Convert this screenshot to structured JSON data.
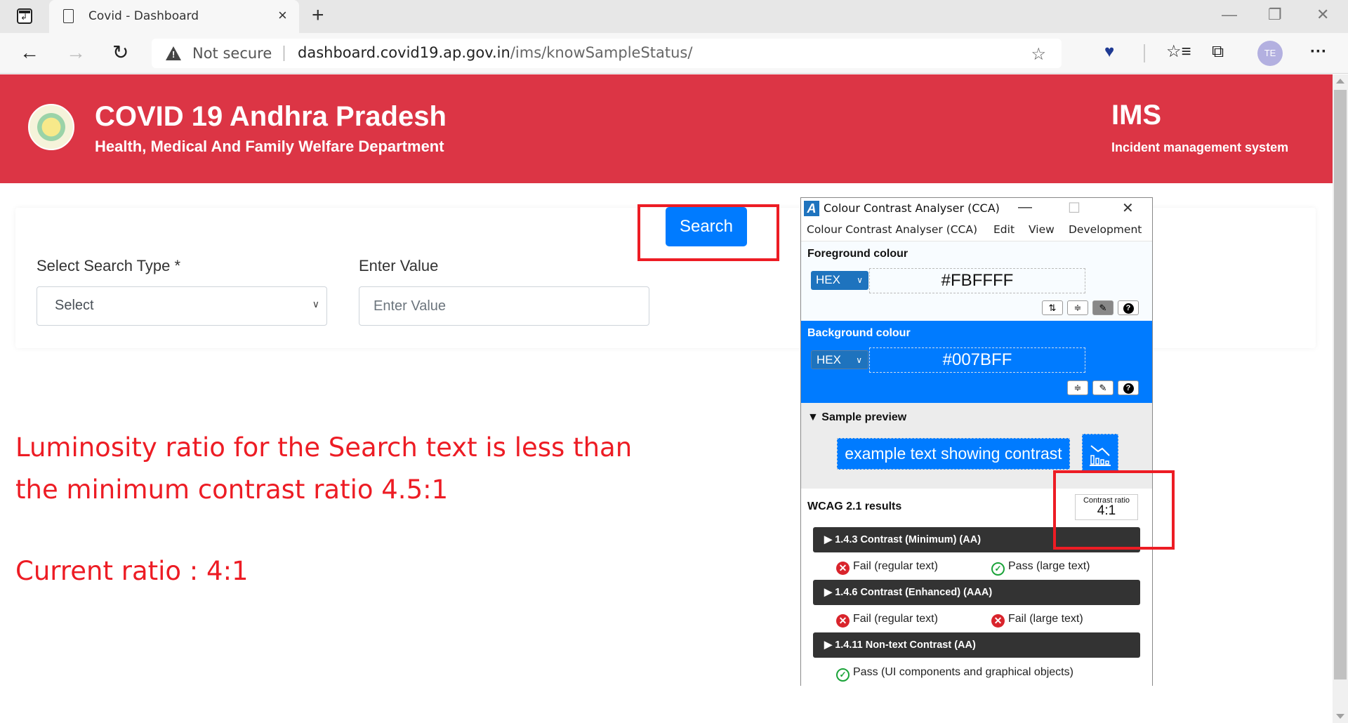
{
  "browser": {
    "tab_title": "Covid - Dashboard",
    "tab_close": "×",
    "new_tab": "+",
    "window_controls": {
      "minimize": "—",
      "restore": "❐",
      "close": "✕"
    },
    "nav": {
      "back": "←",
      "forward": "→",
      "refresh": "↻"
    },
    "security_label": "Not secure",
    "url_host": "dashboard.covid19.ap.gov.in",
    "url_path": "/ims/knowSampleStatus/",
    "profile_initials": "TE",
    "icons": [
      "tab-actions-icon",
      "page-icon",
      "warning-icon",
      "add-favorite-icon",
      "heart-shield-icon",
      "favorites-icon",
      "collections-icon",
      "more-icon"
    ]
  },
  "header": {
    "title": "COVID 19 Andhra Pradesh",
    "subtitle": "Health, Medical And Family Welfare Department",
    "ims_title": "IMS",
    "ims_subtitle": "Incident management system",
    "brand_color": "#DC3545"
  },
  "search_form": {
    "search_type_label": "Select Search Type *",
    "search_type_value": "Select",
    "value_label": "Enter Value",
    "value_placeholder": "Enter Value",
    "search_button_label": "Search",
    "button_bg_color": "#007BFF",
    "button_text_color": "#FBFFFF"
  },
  "annotation": {
    "line1": "Luminosity ratio for the Search text is  less than",
    "line2": "the minimum contrast ratio 4.5:1",
    "line3": "Current ratio : 4:1",
    "highlight_color": "#ED1C24"
  },
  "cca": {
    "window_title": "Colour Contrast Analyser (CCA)",
    "window_controls": {
      "minimize": "—",
      "maximize": "☐",
      "close": "✕"
    },
    "menu": [
      "Colour Contrast Analyser (CCA)",
      "Edit",
      "View",
      "Development"
    ],
    "foreground": {
      "title": "Foreground colour",
      "format": "HEX",
      "value": "#FBFFFF",
      "buttons": [
        "swap-icon",
        "sliders-icon",
        "eyedropper-icon",
        "help-icon"
      ]
    },
    "background": {
      "title": "Background colour",
      "format": "HEX",
      "value": "#007BFF",
      "buttons": [
        "sliders-icon",
        "eyedropper-icon",
        "help-icon"
      ]
    },
    "preview": {
      "title": "Sample preview",
      "sample_text": "example text showing contrast"
    },
    "results": {
      "title": "WCAG 2.1 results",
      "ratio_label": "Contrast ratio",
      "ratio_value": "4:1",
      "criteria": [
        {
          "label": "1.4.3 Contrast (Minimum) (AA)",
          "results": [
            {
              "status": "fail",
              "text": "Fail (regular text)"
            },
            {
              "status": "pass",
              "text": "Pass (large text)"
            }
          ]
        },
        {
          "label": "1.4.6 Contrast (Enhanced) (AAA)",
          "results": [
            {
              "status": "fail",
              "text": "Fail (regular text)"
            },
            {
              "status": "fail",
              "text": "Fail (large text)"
            }
          ]
        },
        {
          "label": "1.4.11 Non-text Contrast (AA)",
          "results": [
            {
              "status": "pass",
              "text": "Pass (UI components and graphical objects)"
            }
          ]
        }
      ]
    }
  }
}
